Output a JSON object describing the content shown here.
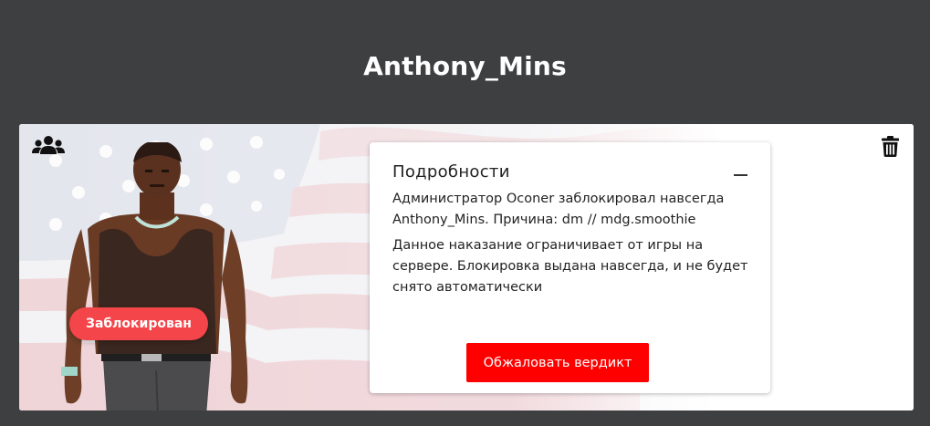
{
  "player": {
    "name": "Anthony_Mins"
  },
  "card": {
    "group_icon": "group-users-icon",
    "delete_icon": "trash-icon",
    "status_badge": "Заблокирован",
    "status_color": "#f4454a"
  },
  "details": {
    "title": "Подробности",
    "collapse_icon": "minus-icon",
    "paragraph_1": "Администратор Oconer заблокировал навсегда Anthony_Mins. Причина: dm // mdg.smoothie",
    "paragraph_2": "Данное наказание ограничивает от игры на сервере. Блокировка выдана навсегда, и не будет снято автоматически",
    "appeal_button": "Обжаловать вердикт",
    "appeal_color": "#ff0000"
  },
  "colors": {
    "page_background": "#3e3f41",
    "card_background": "#ffffff"
  }
}
